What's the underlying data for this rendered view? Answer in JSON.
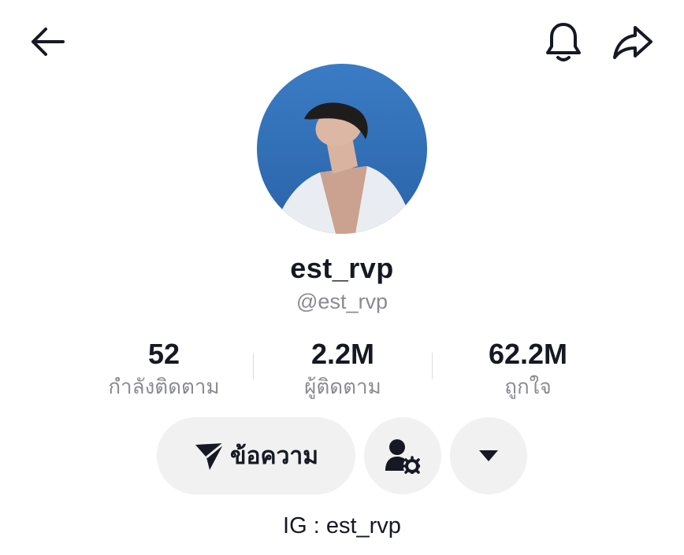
{
  "header": {
    "back_icon": "arrow-left-icon",
    "bell_icon": "bell-icon",
    "share_icon": "share-arrow-icon"
  },
  "profile": {
    "avatar_icon": "profile-photo",
    "display_name": "est_rvp",
    "handle": "@est_rvp"
  },
  "stats": [
    {
      "value": "52",
      "label": "กำลังติดตาม"
    },
    {
      "value": "2.2M",
      "label": "ผู้ติดตาม"
    },
    {
      "value": "62.2M",
      "label": "ถูกใจ"
    }
  ],
  "actions": {
    "message_label": "ข้อความ",
    "message_icon": "send-icon",
    "friends_icon": "person-settings-icon",
    "more_icon": "caret-down-icon"
  },
  "bio": "IG : est_rvp",
  "colors": {
    "text_primary": "#161823",
    "text_secondary": "#8a8b91",
    "button_bg": "#f1f1f2",
    "avatar_sky": "#2e6fb8"
  }
}
